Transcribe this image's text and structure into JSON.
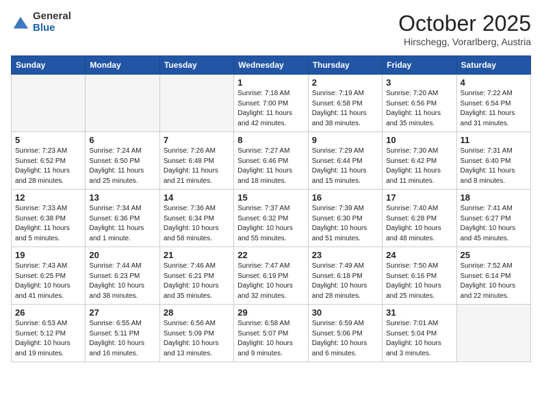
{
  "header": {
    "logo_general": "General",
    "logo_blue": "Blue",
    "month_title": "October 2025",
    "subtitle": "Hirschegg, Vorarlberg, Austria"
  },
  "weekdays": [
    "Sunday",
    "Monday",
    "Tuesday",
    "Wednesday",
    "Thursday",
    "Friday",
    "Saturday"
  ],
  "weeks": [
    [
      {
        "day": "",
        "info": ""
      },
      {
        "day": "",
        "info": ""
      },
      {
        "day": "",
        "info": ""
      },
      {
        "day": "1",
        "info": "Sunrise: 7:18 AM\nSunset: 7:00 PM\nDaylight: 11 hours and 42 minutes."
      },
      {
        "day": "2",
        "info": "Sunrise: 7:19 AM\nSunset: 6:58 PM\nDaylight: 11 hours and 38 minutes."
      },
      {
        "day": "3",
        "info": "Sunrise: 7:20 AM\nSunset: 6:56 PM\nDaylight: 11 hours and 35 minutes."
      },
      {
        "day": "4",
        "info": "Sunrise: 7:22 AM\nSunset: 6:54 PM\nDaylight: 11 hours and 31 minutes."
      }
    ],
    [
      {
        "day": "5",
        "info": "Sunrise: 7:23 AM\nSunset: 6:52 PM\nDaylight: 11 hours and 28 minutes."
      },
      {
        "day": "6",
        "info": "Sunrise: 7:24 AM\nSunset: 6:50 PM\nDaylight: 11 hours and 25 minutes."
      },
      {
        "day": "7",
        "info": "Sunrise: 7:26 AM\nSunset: 6:48 PM\nDaylight: 11 hours and 21 minutes."
      },
      {
        "day": "8",
        "info": "Sunrise: 7:27 AM\nSunset: 6:46 PM\nDaylight: 11 hours and 18 minutes."
      },
      {
        "day": "9",
        "info": "Sunrise: 7:29 AM\nSunset: 6:44 PM\nDaylight: 11 hours and 15 minutes."
      },
      {
        "day": "10",
        "info": "Sunrise: 7:30 AM\nSunset: 6:42 PM\nDaylight: 11 hours and 11 minutes."
      },
      {
        "day": "11",
        "info": "Sunrise: 7:31 AM\nSunset: 6:40 PM\nDaylight: 11 hours and 8 minutes."
      }
    ],
    [
      {
        "day": "12",
        "info": "Sunrise: 7:33 AM\nSunset: 6:38 PM\nDaylight: 11 hours and 5 minutes."
      },
      {
        "day": "13",
        "info": "Sunrise: 7:34 AM\nSunset: 6:36 PM\nDaylight: 11 hours and 1 minute."
      },
      {
        "day": "14",
        "info": "Sunrise: 7:36 AM\nSunset: 6:34 PM\nDaylight: 10 hours and 58 minutes."
      },
      {
        "day": "15",
        "info": "Sunrise: 7:37 AM\nSunset: 6:32 PM\nDaylight: 10 hours and 55 minutes."
      },
      {
        "day": "16",
        "info": "Sunrise: 7:39 AM\nSunset: 6:30 PM\nDaylight: 10 hours and 51 minutes."
      },
      {
        "day": "17",
        "info": "Sunrise: 7:40 AM\nSunset: 6:28 PM\nDaylight: 10 hours and 48 minutes."
      },
      {
        "day": "18",
        "info": "Sunrise: 7:41 AM\nSunset: 6:27 PM\nDaylight: 10 hours and 45 minutes."
      }
    ],
    [
      {
        "day": "19",
        "info": "Sunrise: 7:43 AM\nSunset: 6:25 PM\nDaylight: 10 hours and 41 minutes."
      },
      {
        "day": "20",
        "info": "Sunrise: 7:44 AM\nSunset: 6:23 PM\nDaylight: 10 hours and 38 minutes."
      },
      {
        "day": "21",
        "info": "Sunrise: 7:46 AM\nSunset: 6:21 PM\nDaylight: 10 hours and 35 minutes."
      },
      {
        "day": "22",
        "info": "Sunrise: 7:47 AM\nSunset: 6:19 PM\nDaylight: 10 hours and 32 minutes."
      },
      {
        "day": "23",
        "info": "Sunrise: 7:49 AM\nSunset: 6:18 PM\nDaylight: 10 hours and 28 minutes."
      },
      {
        "day": "24",
        "info": "Sunrise: 7:50 AM\nSunset: 6:16 PM\nDaylight: 10 hours and 25 minutes."
      },
      {
        "day": "25",
        "info": "Sunrise: 7:52 AM\nSunset: 6:14 PM\nDaylight: 10 hours and 22 minutes."
      }
    ],
    [
      {
        "day": "26",
        "info": "Sunrise: 6:53 AM\nSunset: 5:12 PM\nDaylight: 10 hours and 19 minutes."
      },
      {
        "day": "27",
        "info": "Sunrise: 6:55 AM\nSunset: 5:11 PM\nDaylight: 10 hours and 16 minutes."
      },
      {
        "day": "28",
        "info": "Sunrise: 6:56 AM\nSunset: 5:09 PM\nDaylight: 10 hours and 13 minutes."
      },
      {
        "day": "29",
        "info": "Sunrise: 6:58 AM\nSunset: 5:07 PM\nDaylight: 10 hours and 9 minutes."
      },
      {
        "day": "30",
        "info": "Sunrise: 6:59 AM\nSunset: 5:06 PM\nDaylight: 10 hours and 6 minutes."
      },
      {
        "day": "31",
        "info": "Sunrise: 7:01 AM\nSunset: 5:04 PM\nDaylight: 10 hours and 3 minutes."
      },
      {
        "day": "",
        "info": ""
      }
    ]
  ]
}
